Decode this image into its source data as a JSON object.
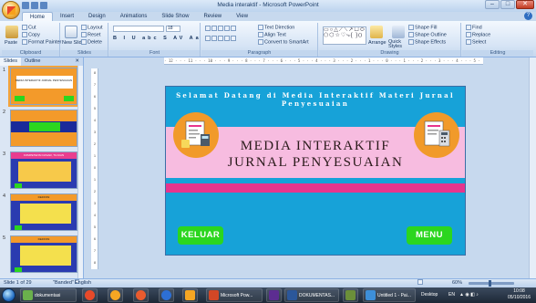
{
  "window": {
    "title": "Media interaktif - Microsoft PowerPoint",
    "controls": [
      "–",
      "□",
      "✕"
    ]
  },
  "tabs": [
    "Home",
    "Insert",
    "Design",
    "Animations",
    "Slide Show",
    "Review",
    "View"
  ],
  "active_tab": "Home",
  "ribbon": {
    "clipboard": {
      "name": "Clipboard",
      "paste": "Paste",
      "cut": "Cut",
      "copy": "Copy",
      "format_painter": "Format Painter"
    },
    "slides": {
      "name": "Slides",
      "new_slide": "New Slide",
      "layout": "Layout",
      "reset": "Reset",
      "delete": "Delete"
    },
    "font": {
      "name": "Font",
      "size": "18",
      "styles": [
        "B",
        "I",
        "U",
        "abc",
        "S",
        "AV",
        "Aa",
        "A"
      ]
    },
    "paragraph": {
      "name": "Paragraph",
      "text_direction": "Text Direction",
      "align_text": "Align Text",
      "smartart": "Convert to SmartArt"
    },
    "drawing": {
      "name": "Drawing",
      "arrange": "Arrange",
      "quick_styles": "Quick Styles",
      "shape_fill": "Shape Fill",
      "shape_outline": "Shape Outline",
      "shape_effects": "Shape Effects"
    },
    "editing": {
      "name": "Editing",
      "find": "Find",
      "replace": "Replace",
      "select": "Select"
    }
  },
  "left_panel": {
    "tabs": [
      "Slides",
      "Outline"
    ],
    "close": "✕",
    "thumbnails": [
      {
        "num": "1",
        "title": "MEDIA INTERAKTIF JURNAL PENYESUAIAN"
      },
      {
        "num": "2",
        "title": ""
      },
      {
        "num": "3",
        "title": "KOMPETENSI DASAR, TUJUAN"
      },
      {
        "num": "4",
        "title": "DEFINISI"
      },
      {
        "num": "5",
        "title": "DEFINISI"
      }
    ]
  },
  "ruler": {
    "horizontal": "· 12 · · · 11 · · · 10 · · · 9 · · · 8 · · · 7 · · · 6 · · · 5 · · · 4 · · · 3 · · · 2 · · · 1 · · · 0 · · · 1 · · · 2 · · · 3 · · · 4 · · · 5 · · · 6 · · · 7 · · · 8 · · · 9 · · · 10 · · · 11 · · · 12 ·",
    "vertical": [
      "8",
      "7",
      "6",
      "5",
      "4",
      "3",
      "2",
      "1",
      "0",
      "1",
      "2",
      "3",
      "4",
      "5",
      "6",
      "7",
      "8"
    ]
  },
  "slide": {
    "welcome": "Selamat Datang di Media Interaktif Materi Jurnal Penyesuaian",
    "title_line1": "MEDIA INTERAKTIF",
    "title_line2": "JURNAL PENYESUAIAN",
    "btn_left": "KELUAR",
    "btn_right": "MENU",
    "colors": {
      "background": "#17a2d8",
      "pink_band": "#f7bce0",
      "magenta_band": "#e7358d",
      "button": "#2bd61f",
      "deco_circle": "#f19a2a"
    }
  },
  "status": {
    "slide_info": "Slide 1 of 29",
    "theme": "\"Banded\"",
    "language": "English (United States)",
    "zoom": "60%"
  },
  "taskbar": {
    "apps": [
      {
        "label": "dokumentasi",
        "color": "#6ab04c"
      },
      {
        "label": "",
        "color": "#e84a2a"
      },
      {
        "label": "",
        "color": "#f5a623"
      },
      {
        "label": "",
        "color": "#2d6fd4"
      },
      {
        "label": "",
        "color": "#e95b2e"
      },
      {
        "label": "",
        "color": "#2f6fd0"
      },
      {
        "label": "Microsoft Pow...",
        "color": "#d24726"
      },
      {
        "label": "",
        "color": "#5c2d91"
      },
      {
        "label": "DOKUMENTAS...",
        "color": "#2b579a"
      },
      {
        "label": "",
        "color": "#6b8f3a"
      },
      {
        "label": "Untitled 1 - Pai...",
        "color": "#3d8fd9"
      }
    ],
    "desktop": "Desktop",
    "lang": "EN",
    "time": "10:08",
    "date": "05/10/2016"
  }
}
